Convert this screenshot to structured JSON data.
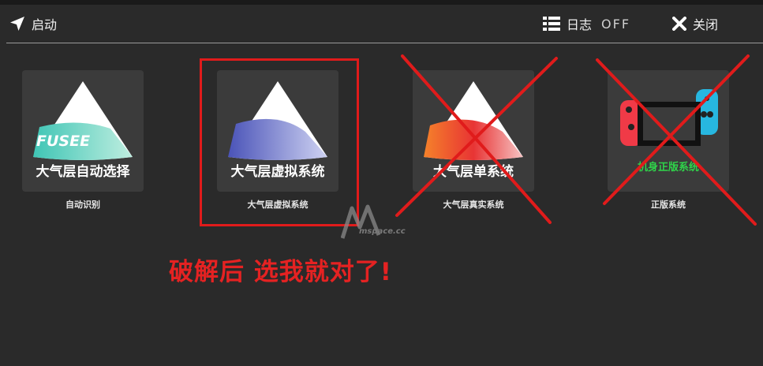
{
  "header": {
    "launch_label": "启动",
    "log_label": "日志",
    "log_state": "OFF",
    "close_label": "关闭"
  },
  "icons": {
    "launch": "navigation-arrow-icon",
    "log": "list-icon",
    "close": "close-icon"
  },
  "tiles": [
    {
      "image_text": "大气层自动选择",
      "badge": "FUSEE",
      "caption": "自动识别",
      "crossed": false
    },
    {
      "image_text": "大气层虚拟系统",
      "caption": "大气层虚拟系统",
      "crossed": false,
      "highlighted": true
    },
    {
      "image_text": "大气层单系统",
      "caption": "大气层真实系统",
      "crossed": true
    },
    {
      "image_text": "机身正版系统",
      "caption": "正版系统",
      "crossed": true
    }
  ],
  "annotation": {
    "promo_text": "破解后 选我就对了!",
    "watermark": "mspace.cc",
    "accent_color": "#e01b1b"
  }
}
